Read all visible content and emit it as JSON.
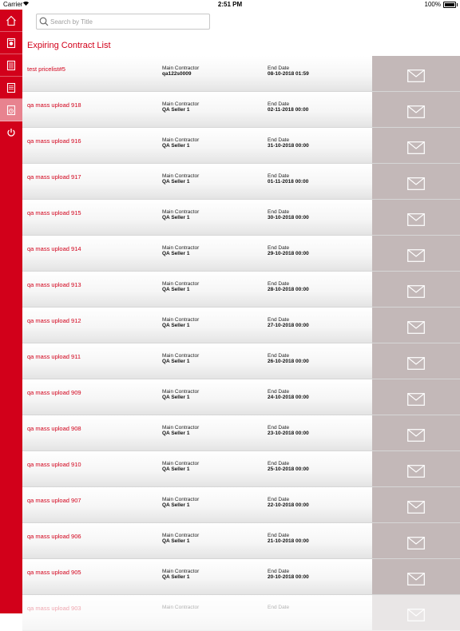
{
  "status": {
    "carrier": "Carrier",
    "time": "2:51 PM",
    "battery": "100%"
  },
  "search": {
    "placeholder": "Search by Title"
  },
  "page": {
    "title": "Expiring Contract List"
  },
  "labels": {
    "main_contractor": "Main Contractor",
    "end_date": "End Date"
  },
  "sidebar": {
    "items": [
      {
        "icon": "home-icon"
      },
      {
        "icon": "contract-icon"
      },
      {
        "icon": "document-list-icon"
      },
      {
        "icon": "document-icon"
      },
      {
        "icon": "expiring-contract-icon"
      },
      {
        "icon": "power-icon"
      }
    ]
  },
  "contracts": [
    {
      "title": "test pricelist#5",
      "contractor": "qa122s0009",
      "end_date": "08-10-2018 01:59"
    },
    {
      "title": "qa mass upload 918",
      "contractor": "QA Seller 1",
      "end_date": "02-11-2018 00:00"
    },
    {
      "title": "qa mass upload 916",
      "contractor": "QA Seller 1",
      "end_date": "31-10-2018 00:00"
    },
    {
      "title": "qa mass upload 917",
      "contractor": "QA Seller 1",
      "end_date": "01-11-2018 00:00"
    },
    {
      "title": "qa mass upload 915",
      "contractor": "QA Seller 1",
      "end_date": "30-10-2018 00:00"
    },
    {
      "title": "qa mass upload 914",
      "contractor": "QA Seller 1",
      "end_date": "29-10-2018 00:00"
    },
    {
      "title": "qa mass upload 913",
      "contractor": "QA Seller 1",
      "end_date": "28-10-2018 00:00"
    },
    {
      "title": "qa mass upload 912",
      "contractor": "QA Seller 1",
      "end_date": "27-10-2018 00:00"
    },
    {
      "title": "qa mass upload 911",
      "contractor": "QA Seller 1",
      "end_date": "26-10-2018 00:00"
    },
    {
      "title": "qa mass upload 909",
      "contractor": "QA Seller 1",
      "end_date": "24-10-2018 00:00"
    },
    {
      "title": "qa mass upload 908",
      "contractor": "QA Seller 1",
      "end_date": "23-10-2018 00:00"
    },
    {
      "title": "qa mass upload 910",
      "contractor": "QA Seller 1",
      "end_date": "25-10-2018 00:00"
    },
    {
      "title": "qa mass upload 907",
      "contractor": "QA Seller 1",
      "end_date": "22-10-2018 00:00"
    },
    {
      "title": "qa mass upload 906",
      "contractor": "QA Seller 1",
      "end_date": "21-10-2018 00:00"
    },
    {
      "title": "qa mass upload 905",
      "contractor": "QA Seller 1",
      "end_date": "20-10-2018 00:00"
    },
    {
      "title": "qa mass upload 903",
      "contractor": "",
      "end_date": ""
    }
  ]
}
